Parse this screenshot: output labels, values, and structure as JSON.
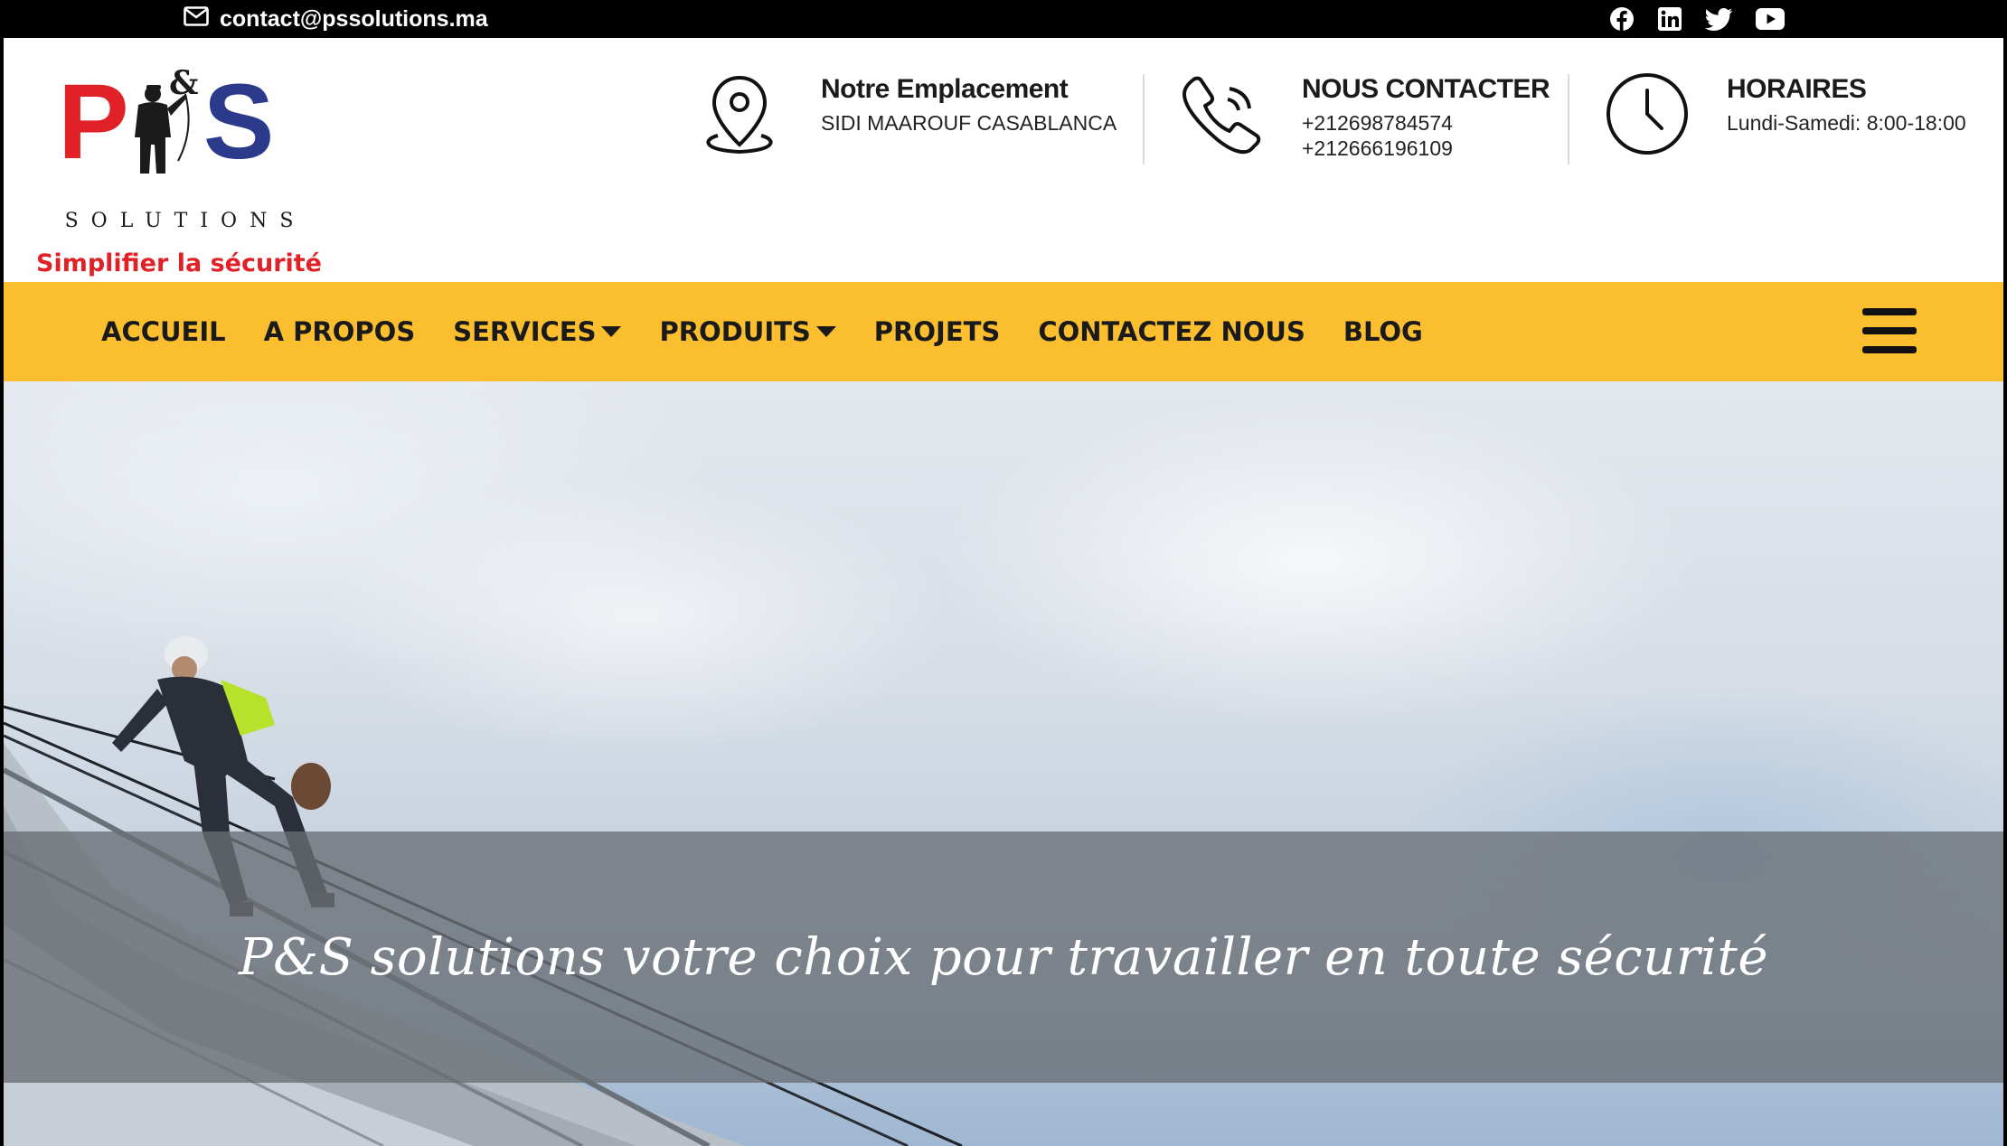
{
  "topbar": {
    "email": "contact@pssolutions.ma",
    "email_icon": "envelope-icon",
    "social_icons": [
      "facebook-icon",
      "linkedin-icon",
      "twitter-icon",
      "youtube-icon"
    ]
  },
  "logo": {
    "letter_left": "P",
    "ampersand": "&",
    "letter_right": "S",
    "wordmark": "SOLUTIONS",
    "tagline": "Simplifier la sécurité"
  },
  "info": [
    {
      "icon": "map-pin-icon",
      "title": "Notre Emplacement",
      "lines": [
        "SIDI MAAROUF CASABLANCA"
      ]
    },
    {
      "icon": "phone-icon",
      "title": "NOUS CONTACTER",
      "lines": [
        "+212698784574",
        "+212666196109"
      ]
    },
    {
      "icon": "clock-icon",
      "title": "HORAIRES",
      "lines": [
        "Lundi-Samedi: 8:00-18:00"
      ]
    }
  ],
  "nav": {
    "items": [
      {
        "label": "ACCUEIL",
        "dropdown": false
      },
      {
        "label": "A PROPOS",
        "dropdown": false
      },
      {
        "label": "SERVICES",
        "dropdown": true
      },
      {
        "label": "PRODUITS",
        "dropdown": true
      },
      {
        "label": "PROJETS",
        "dropdown": false
      },
      {
        "label": "CONTACTEZ NOUS",
        "dropdown": false
      },
      {
        "label": "BLOG",
        "dropdown": false
      }
    ],
    "menu_icon": "hamburger-menu-icon"
  },
  "hero": {
    "headline": "P&S solutions votre choix pour travailler en toute sécurité"
  },
  "colors": {
    "nav_background": "#fbbe2e",
    "brand_red": "#e02127",
    "brand_blue": "#2c3a8c",
    "topbar_background": "#000000"
  }
}
